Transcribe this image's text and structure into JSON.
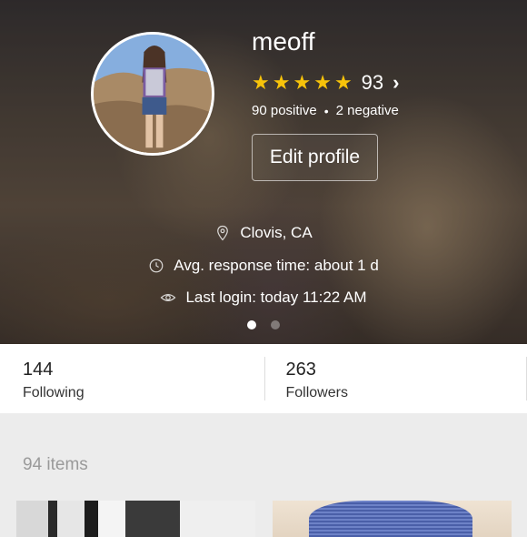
{
  "profile": {
    "username": "meoff",
    "rating_count": "93",
    "stars": 5,
    "positive": "90 positive",
    "negative": "2 negative",
    "edit_label": "Edit profile",
    "location": "Clovis, CA",
    "response_time": "Avg. response time: about 1 d",
    "last_login": "Last login: today 11:22 AM",
    "pager_active": 1,
    "pager_total": 2
  },
  "stats": {
    "following_value": "144",
    "following_label": "Following",
    "followers_value": "263",
    "followers_label": "Followers"
  },
  "items": {
    "count_label": "94 items"
  },
  "colors": {
    "star": "#f7c30a",
    "muted_text": "#9a9a9a"
  }
}
